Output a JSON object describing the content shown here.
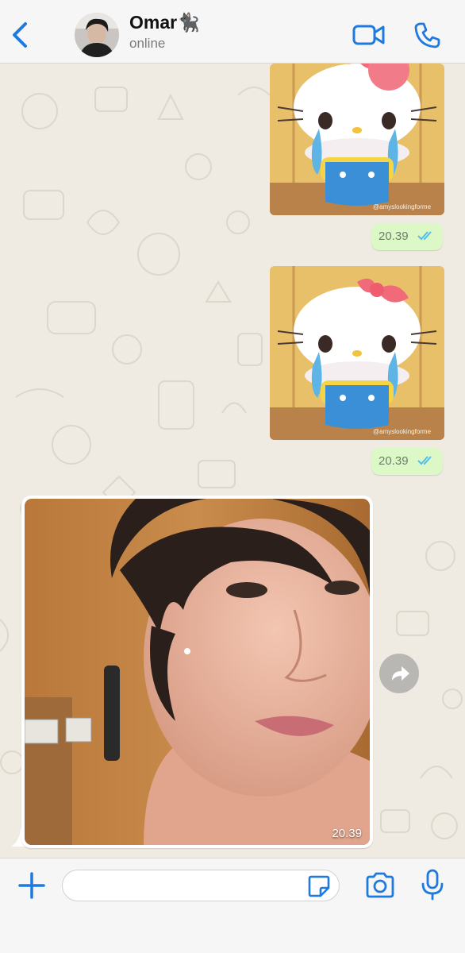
{
  "header": {
    "contact_name": "Omar🐈‍⬛",
    "status": "online",
    "back_icon": "chevron-left-icon",
    "video_icon": "video-camera-icon",
    "call_icon": "phone-icon",
    "accent_color": "#1f7ae0"
  },
  "messages": [
    {
      "type": "image",
      "direction": "outgoing",
      "time": "20.39",
      "status_icon": "double-check-icon"
    },
    {
      "type": "image",
      "direction": "outgoing",
      "time": "20.39",
      "status_icon": "double-check-icon"
    },
    {
      "type": "photo",
      "direction": "incoming",
      "time": "20.39"
    }
  ],
  "image_caption_text": "@amyslookingforme",
  "composer": {
    "placeholder": "",
    "plus_icon": "plus-icon",
    "sticker_icon": "sticker-icon",
    "camera_icon": "camera-icon",
    "mic_icon": "microphone-icon"
  },
  "colors": {
    "chat_background": "#efeae2",
    "outgoing_bubble": "#dcf8c6",
    "read_ticks": "#53bdeb"
  }
}
